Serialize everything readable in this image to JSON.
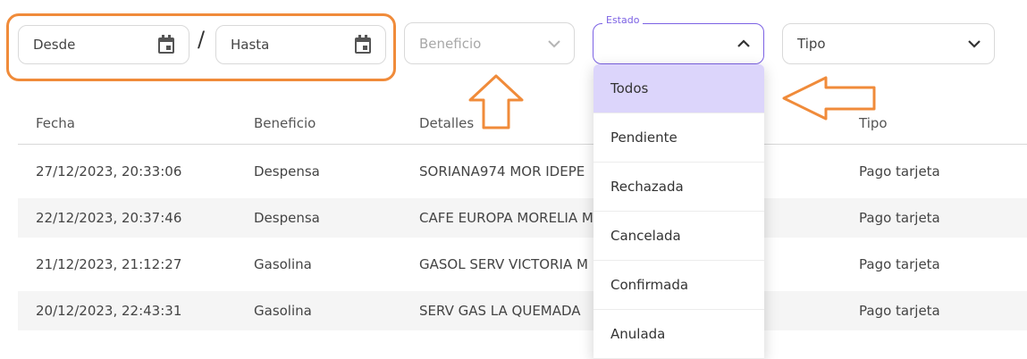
{
  "filters": {
    "desde_placeholder": "Desde",
    "hasta_placeholder": "Hasta",
    "separator": "/",
    "beneficio_placeholder": "Beneficio",
    "estado_label": "Estado",
    "estado_value": "",
    "tipo_placeholder": "Tipo"
  },
  "table": {
    "headers": [
      "Fecha",
      "Beneficio",
      "Detalles",
      "Tipo"
    ],
    "rows": [
      {
        "fecha": "27/12/2023, 20:33:06",
        "beneficio": "Despensa",
        "detalles": "SORIANA974 MOR IDEPE",
        "tipo": "Pago tarjeta"
      },
      {
        "fecha": "22/12/2023, 20:37:46",
        "beneficio": "Despensa",
        "detalles": "CAFE EUROPA MORELIA M",
        "tipo": "Pago tarjeta"
      },
      {
        "fecha": "21/12/2023, 21:12:27",
        "beneficio": "Gasolina",
        "detalles": "GASOL SERV VICTORIA M",
        "tipo": "Pago tarjeta"
      },
      {
        "fecha": "20/12/2023, 22:43:31",
        "beneficio": "Gasolina",
        "detalles": "SERV GAS LA QUEMADA",
        "tipo": "Pago tarjeta"
      }
    ]
  },
  "estado_dropdown": {
    "options": [
      "Todos",
      "Pendiente",
      "Rechazada",
      "Cancelada",
      "Confirmada",
      "Anulada"
    ],
    "selected": "Todos"
  },
  "colors": {
    "accent": "#7c62e4",
    "highlight": "#f08b3a",
    "selected_option_bg": "#dcd5fb"
  }
}
